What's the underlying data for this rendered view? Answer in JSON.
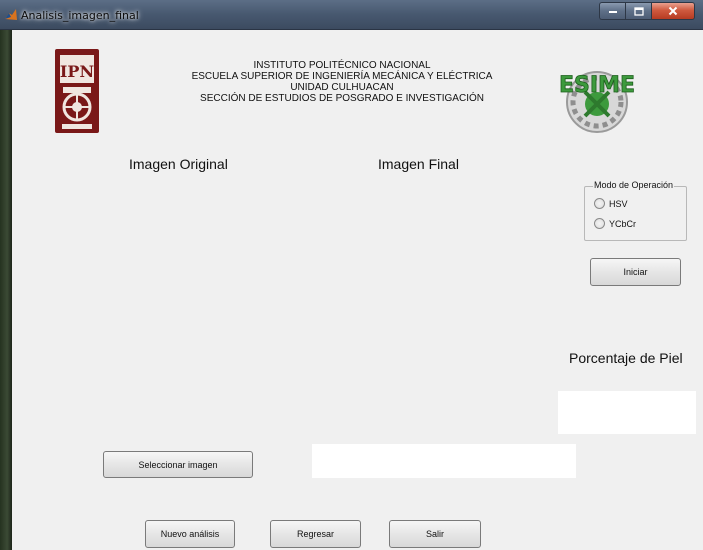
{
  "window": {
    "title": "Analisis_imagen_final"
  },
  "header": {
    "line1": "INSTITUTO POLITÉCNICO NACIONAL",
    "line2": "ESCUELA SUPERIOR DE INGENIERÍA MECÁNICA Y ELÉCTRICA",
    "line3": "UNIDAD CULHUACAN",
    "line4": "SECCIÓN DE ESTUDIOS DE POSGRADO E INVESTIGACIÓN"
  },
  "logos": {
    "ipn": "IPN",
    "esime": "ESIME"
  },
  "labels": {
    "original": "Imagen Original",
    "final": "Imagen Final",
    "porcentaje": "Porcentaje de Piel"
  },
  "mode_group": {
    "title": "Modo de Operación",
    "options": [
      "HSV",
      "YCbCr"
    ]
  },
  "buttons": {
    "iniciar": "Iniciar",
    "seleccionar": "Seleccionar imagen",
    "nuevo": "Nuevo análisis",
    "regresar": "Regresar",
    "salir": "Salir"
  },
  "fields": {
    "porcentaje_value": "",
    "path_value": ""
  },
  "colors": {
    "ipn_maroon": "#7a1818",
    "esime_green": "#3d9a3d",
    "close_red": "#c8452a"
  }
}
